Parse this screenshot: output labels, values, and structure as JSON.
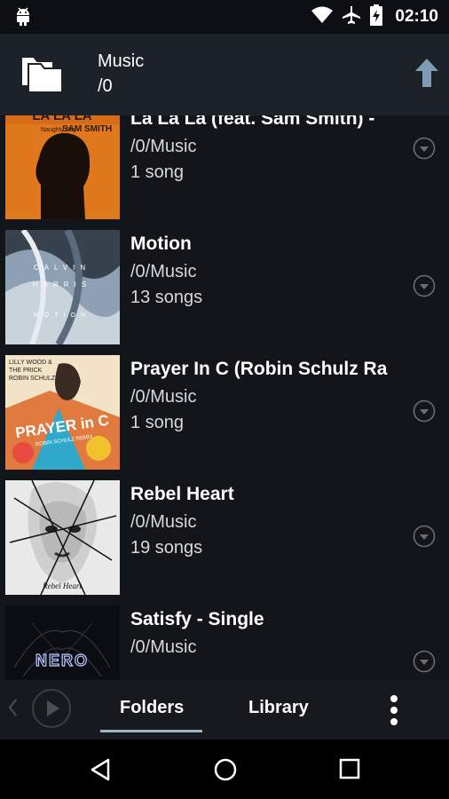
{
  "status_bar": {
    "time": "02:10",
    "icons": [
      "android-icon",
      "wifi-icon",
      "airplane-icon",
      "battery-charging-icon"
    ]
  },
  "header": {
    "title": "Music",
    "path": "/0",
    "icon": "folder-icon",
    "up_icon": "up-arrow-icon"
  },
  "folders": [
    {
      "title": "La La La (feat. Sam Smith) -",
      "path": "/0/Music",
      "count": "1 song",
      "art_text": [
        "LA LA LA",
        "Naughty Boy",
        "SAM SMITH"
      ]
    },
    {
      "title": "Motion",
      "path": "/0/Music",
      "count": "13 songs",
      "art_text": [
        "CALVIN",
        "HARRIS",
        "MOTION"
      ]
    },
    {
      "title": "Prayer In C (Robin Schulz Ra",
      "path": "/0/Music",
      "count": "1 song",
      "art_text": [
        "LILLY WOOD &",
        "THE PRICK",
        "ROBIN SCHULZ",
        "PRAYER in C",
        "ROBIN SCHULZ REMIX"
      ]
    },
    {
      "title": "Rebel Heart",
      "path": "/0/Music",
      "count": "19 songs",
      "art_text": [
        "Rebel Heart"
      ]
    },
    {
      "title": "Satisfy - Single",
      "path": "/0/Music",
      "count": "",
      "art_text": [
        "NERO"
      ]
    }
  ],
  "tabs": {
    "folders": "Folders",
    "library": "Library",
    "active": "Folders"
  },
  "colors": {
    "header_bg": "#1d2128",
    "list_bg": "#121519",
    "tab_underline": "#9fb3c8",
    "up_arrow": "#7f9ab5"
  }
}
